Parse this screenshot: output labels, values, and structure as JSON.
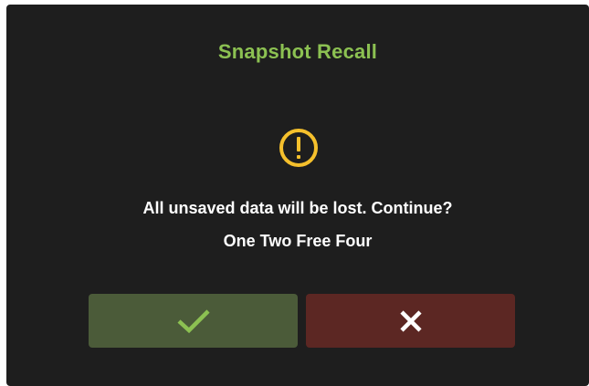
{
  "dialog": {
    "title": "Snapshot Recall",
    "icon": "warning-icon",
    "message": "All unsaved data will be lost. Continue?",
    "detail": "One Two Free Four",
    "confirm_icon": "checkmark-icon",
    "cancel_icon": "close-icon"
  },
  "colors": {
    "background": "#1e1e1e",
    "title": "#8cc152",
    "warning": "#f5c02c",
    "confirm_button": "#4b5b39",
    "confirm_glyph": "#8cc152",
    "cancel_button": "#5c2723",
    "cancel_glyph": "#ffffff"
  }
}
